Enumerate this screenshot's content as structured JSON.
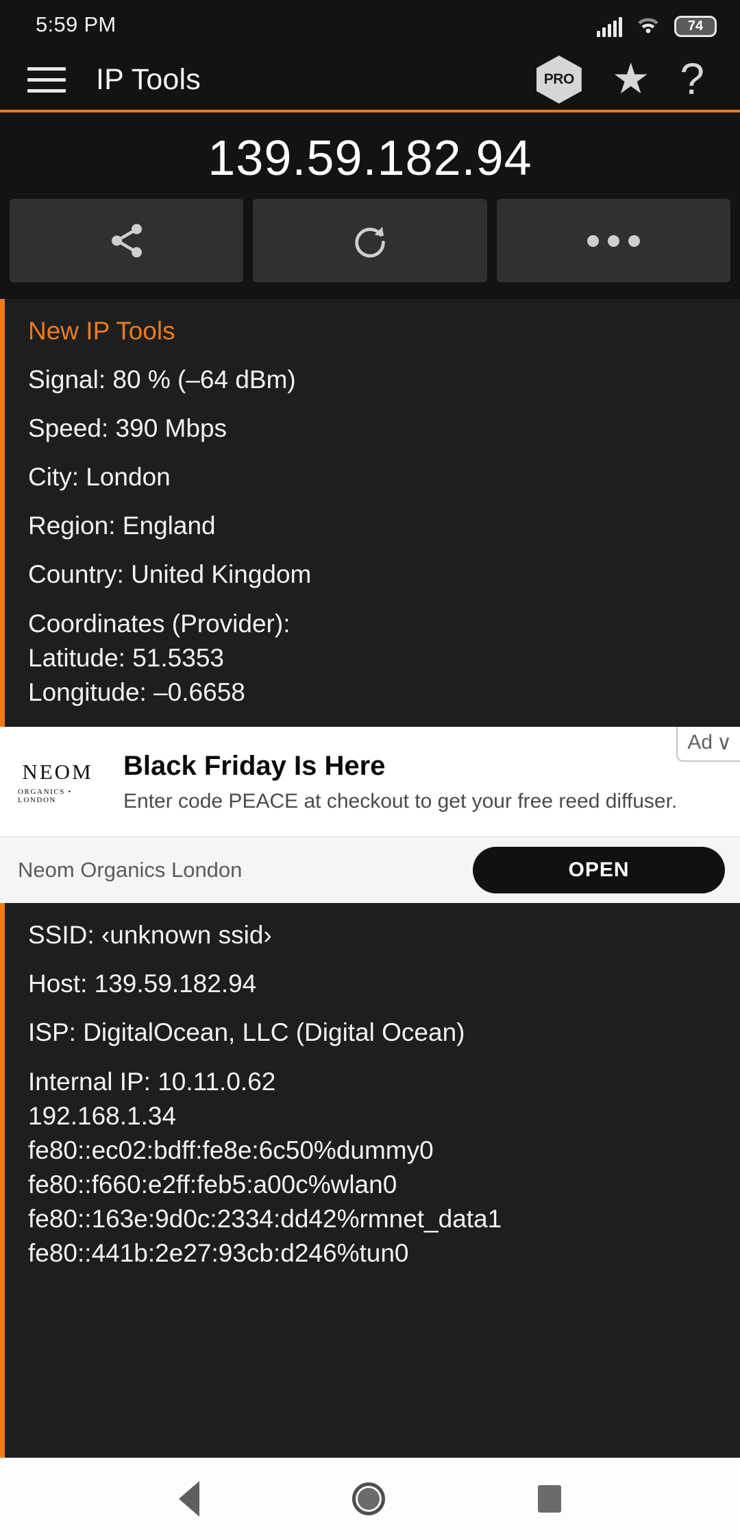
{
  "status_bar": {
    "time": "5:59 PM",
    "battery_level": "74",
    "signal_icon": "cellular-signal-icon",
    "wifi_icon": "wifi-icon"
  },
  "app_bar": {
    "menu_icon": "hamburger-menu-icon",
    "title": "IP Tools",
    "pro_label": "PRO",
    "star_glyph": "★",
    "help_glyph": "?"
  },
  "ip_header": {
    "public_ip": "139.59.182.94"
  },
  "actions": [
    {
      "name": "share-button",
      "icon": "share-icon"
    },
    {
      "name": "refresh-button",
      "icon": "refresh-icon"
    },
    {
      "name": "more-button",
      "icon": "overflow-dots-icon"
    }
  ],
  "info_card": {
    "title": "New IP Tools",
    "rows": [
      "Signal: 80 % (–64 dBm)",
      "Speed: 390 Mbps",
      "City: London",
      "Region: England",
      "Country: United Kingdom"
    ],
    "coordinates_label": "Coordinates (Provider):",
    "latitude": "Latitude: 51.5353",
    "longitude": "Longitude: –0.6658"
  },
  "ad": {
    "badge_label": "Ad",
    "badge_chevron": "∨",
    "logo_brand": "NEOM",
    "logo_subtitle": "ORGANICS • LONDON",
    "headline": "Black Friday Is Here",
    "description": "Enter code PEACE at checkout to get your free reed diffuser.",
    "advertiser": "Neom Organics London",
    "cta_label": "OPEN"
  },
  "network_card": {
    "ssid": "SSID: ‹unknown ssid›",
    "host": "Host: 139.59.182.94",
    "isp": "ISP: DigitalOcean, LLC (Digital Ocean)",
    "internal_ip_label": "Internal IP: 10.11.0.62",
    "addresses": [
      "192.168.1.34",
      "fe80::ec02:bdff:fe8e:6c50%dummy0",
      "fe80::f660:e2ff:feb5:a00c%wlan0",
      "fe80::163e:9d0c:2334:dd42%rmnet_data1",
      "fe80::441b:2e27:93cb:d246%tun0"
    ]
  },
  "nav_bar": {
    "back_icon": "back-triangle-icon",
    "home_icon": "home-circle-icon",
    "recents_icon": "recents-square-icon"
  },
  "colors": {
    "accent": "#ef7b16",
    "background": "#131313",
    "card": "#1e1e1e",
    "button": "#303030"
  }
}
